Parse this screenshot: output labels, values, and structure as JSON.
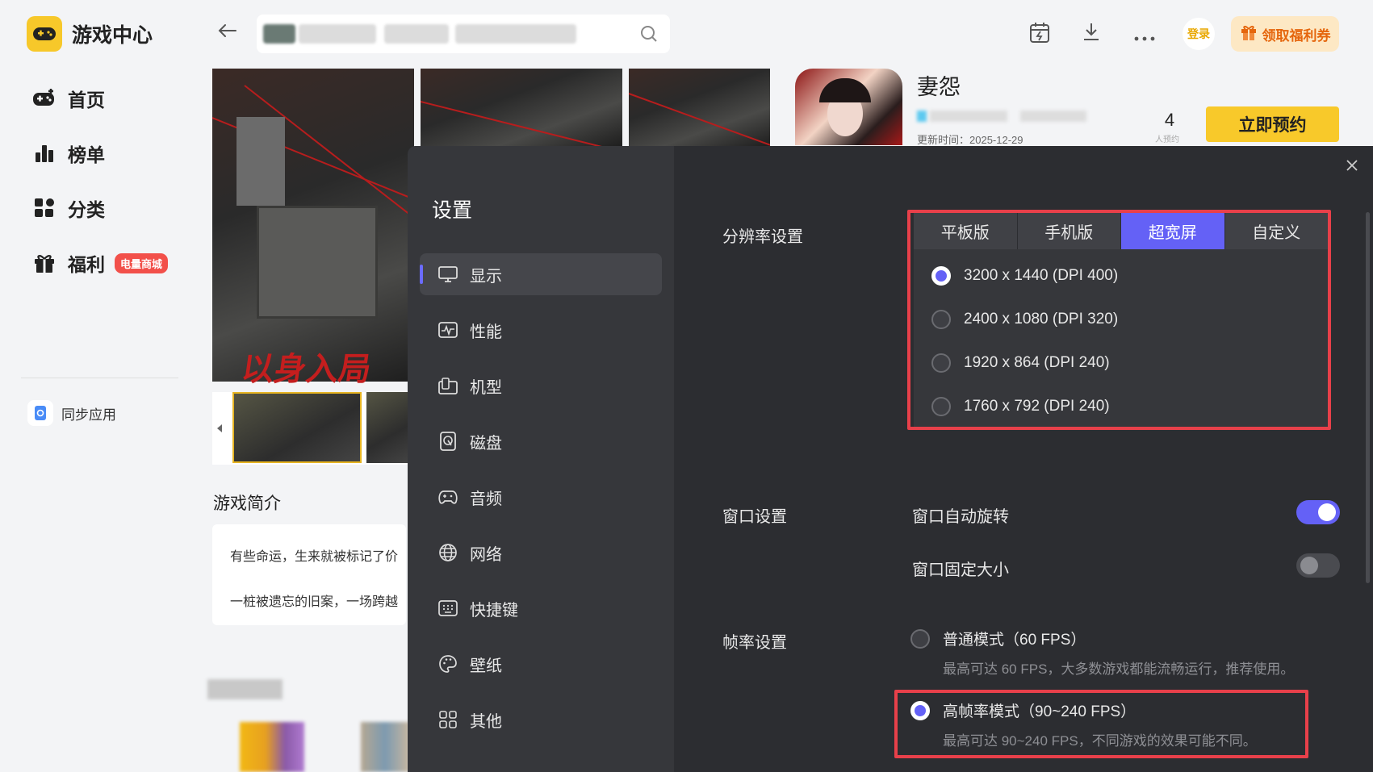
{
  "app": {
    "title": "游戏中心",
    "nav": [
      {
        "label": "首页",
        "icon": "gamepad-icon"
      },
      {
        "label": "榜单",
        "icon": "chart-icon"
      },
      {
        "label": "分类",
        "icon": "category-icon"
      },
      {
        "label": "福利",
        "icon": "gift-icon",
        "badge": "电量商城"
      }
    ],
    "sync_label": "同步应用"
  },
  "topbar": {
    "login_label": "登录",
    "coupon_label": "领取福利券"
  },
  "game": {
    "name": "妻怨",
    "update_time": "更新时间：2025-12-29",
    "reserve_count": "4",
    "reserve_count_label": "人预约",
    "reserve_button": "立即预约",
    "screenshot_title": "以身入局",
    "intro_title": "游戏简介",
    "intro_lines": [
      "有些命运，生来就被标记了价",
      "一桩被遗忘的旧案，一场跨越"
    ]
  },
  "settings": {
    "title": "设置",
    "menu": [
      {
        "label": "显示",
        "icon": "monitor-icon",
        "active": true
      },
      {
        "label": "性能",
        "icon": "performance-icon"
      },
      {
        "label": "机型",
        "icon": "device-icon"
      },
      {
        "label": "磁盘",
        "icon": "disk-icon"
      },
      {
        "label": "音频",
        "icon": "audio-icon"
      },
      {
        "label": "网络",
        "icon": "globe-icon"
      },
      {
        "label": "快捷键",
        "icon": "keyboard-icon"
      },
      {
        "label": "壁纸",
        "icon": "palette-icon"
      },
      {
        "label": "其他",
        "icon": "grid-icon"
      }
    ],
    "resolution": {
      "label": "分辨率设置",
      "tabs": [
        "平板版",
        "手机版",
        "超宽屏",
        "自定义"
      ],
      "active_tab": "超宽屏",
      "options": [
        {
          "label": "3200 x 1440  (DPI 400)",
          "checked": true
        },
        {
          "label": "2400 x 1080  (DPI 320)",
          "checked": false
        },
        {
          "label": "1920 x 864  (DPI 240)",
          "checked": false
        },
        {
          "label": "1760 x 792  (DPI 240)",
          "checked": false
        }
      ]
    },
    "window": {
      "label": "窗口设置",
      "auto_rotate": {
        "label": "窗口自动旋转",
        "on": true
      },
      "fixed_size": {
        "label": "窗口固定大小",
        "on": false
      }
    },
    "fps": {
      "label": "帧率设置",
      "options": [
        {
          "label": "普通模式（60 FPS）",
          "desc": "最高可达 60 FPS，大多数游戏都能流畅运行，推荐使用。",
          "checked": false
        },
        {
          "label": "高帧率模式（90~240 FPS）",
          "desc": "最高可达 90~240 FPS，不同游戏的效果可能不同。",
          "checked": true
        }
      ]
    }
  },
  "colors": {
    "accent": "#6461f6",
    "highlight": "#e8404a",
    "brand": "#f8c92a"
  }
}
